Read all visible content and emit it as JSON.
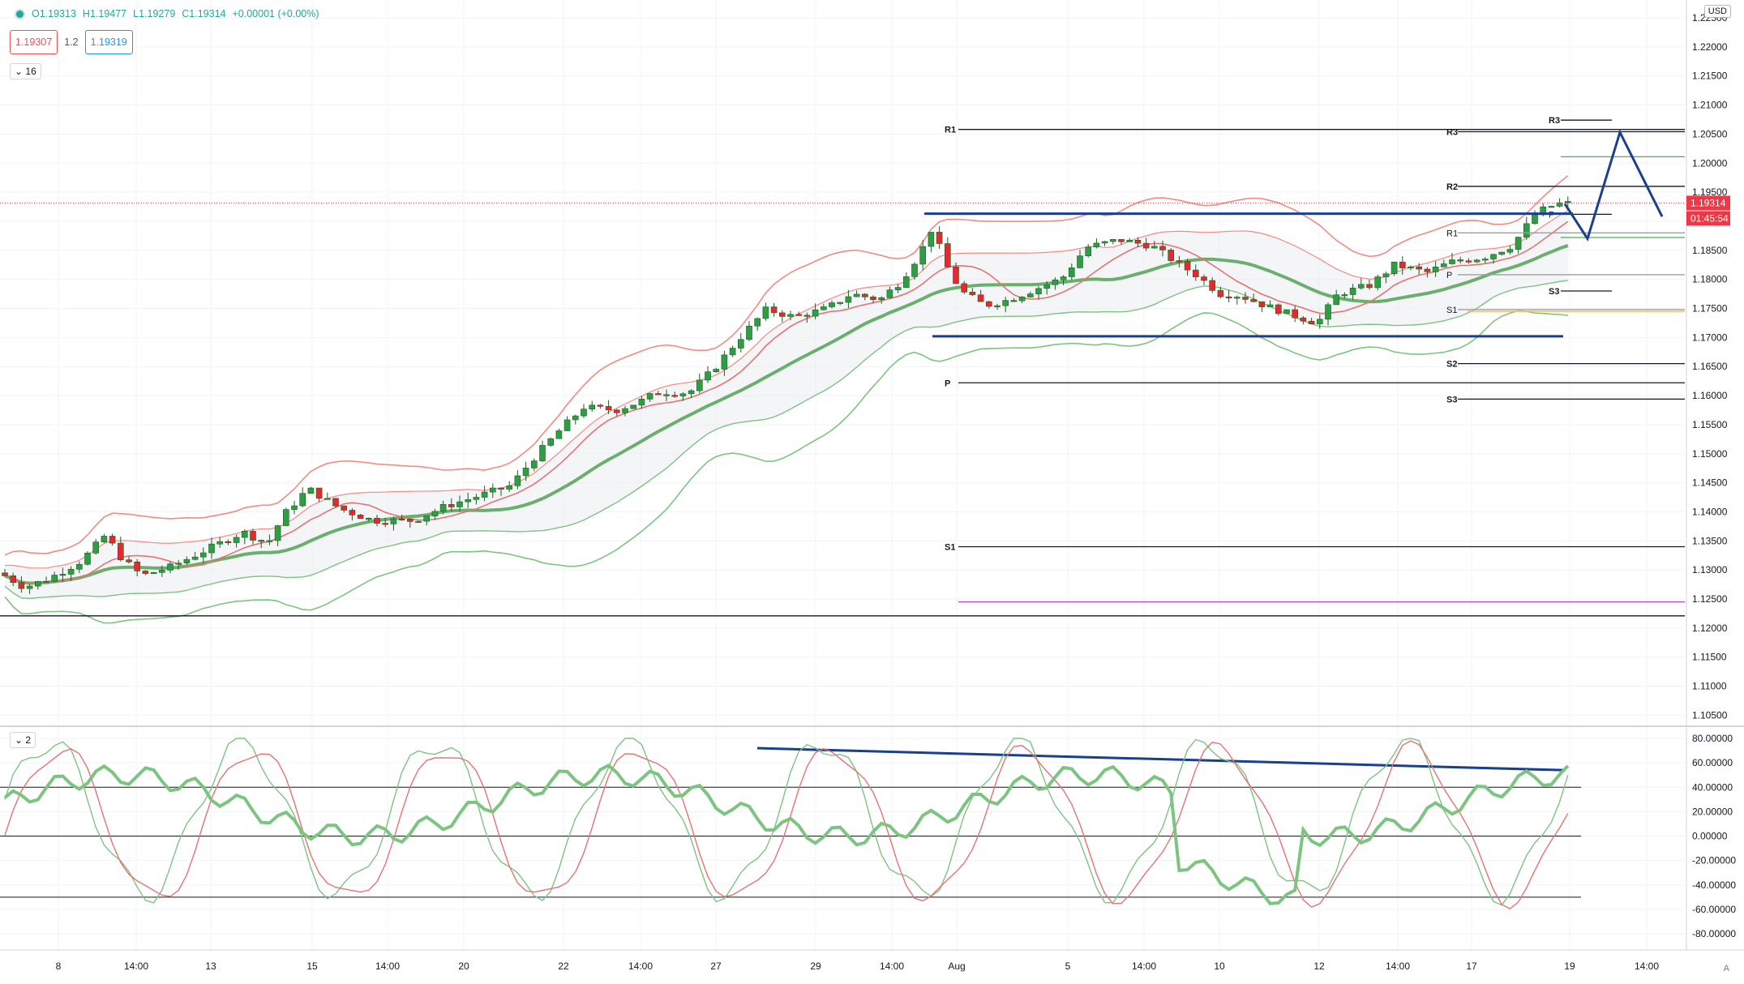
{
  "legend": {
    "open": "O1.19313",
    "high": "H1.19477",
    "low": "L1.19279",
    "close": "C1.19314",
    "change": "+0.00001 (+0.00%)"
  },
  "quote": {
    "bid": "1.19307",
    "spread": "1.2",
    "ask": "1.19319"
  },
  "indicator_toggles": {
    "main": "16",
    "oscillator": "2"
  },
  "price_axis": {
    "currency": "USD",
    "ticks": [
      "1.22500",
      "1.22000",
      "1.21500",
      "1.21000",
      "1.20500",
      "1.20000",
      "1.19500",
      "1.19000",
      "1.18500",
      "1.18000",
      "1.17500",
      "1.17000",
      "1.16500",
      "1.16000",
      "1.15500",
      "1.15000",
      "1.14500",
      "1.14000",
      "1.13500",
      "1.13000",
      "1.12500",
      "1.12000",
      "1.11500",
      "1.11000",
      "1.10500"
    ],
    "top_partial": "1.22500",
    "last_price": "1.19314",
    "countdown": "01:45:54",
    "last_price_color": "#f23645"
  },
  "osc_axis": {
    "ticks": [
      "80.00000",
      "60.00000",
      "40.00000",
      "20.00000",
      "0.00000",
      "-20.00000",
      "-40.00000",
      "-60.00000",
      "-80.00000"
    ]
  },
  "time_axis": {
    "labels": [
      "8",
      "14:00",
      "13",
      "15",
      "14:00",
      "20",
      "22",
      "14:00",
      "27",
      "29",
      "14:00",
      "Aug",
      "5",
      "14:00",
      "10",
      "12",
      "14:00",
      "17",
      "19",
      "14:00"
    ]
  },
  "pivots": {
    "monthly": {
      "R1": "R1",
      "P": "P",
      "S1": "S1"
    },
    "weekly": {
      "R3": "R3",
      "R2": "R2",
      "R1": "R1",
      "P": "P",
      "S1": "S1",
      "S2": "S2",
      "S3": "S3"
    },
    "daily": {
      "R3": "R3",
      "P": "P",
      "S3": "S3"
    }
  },
  "auto_label": "A",
  "colors": {
    "up": "#2e9e45",
    "down": "#e8272f",
    "band_red": "#f28b82",
    "band_green": "#7cc47f",
    "trend_blue": "#1a3f8f"
  }
}
